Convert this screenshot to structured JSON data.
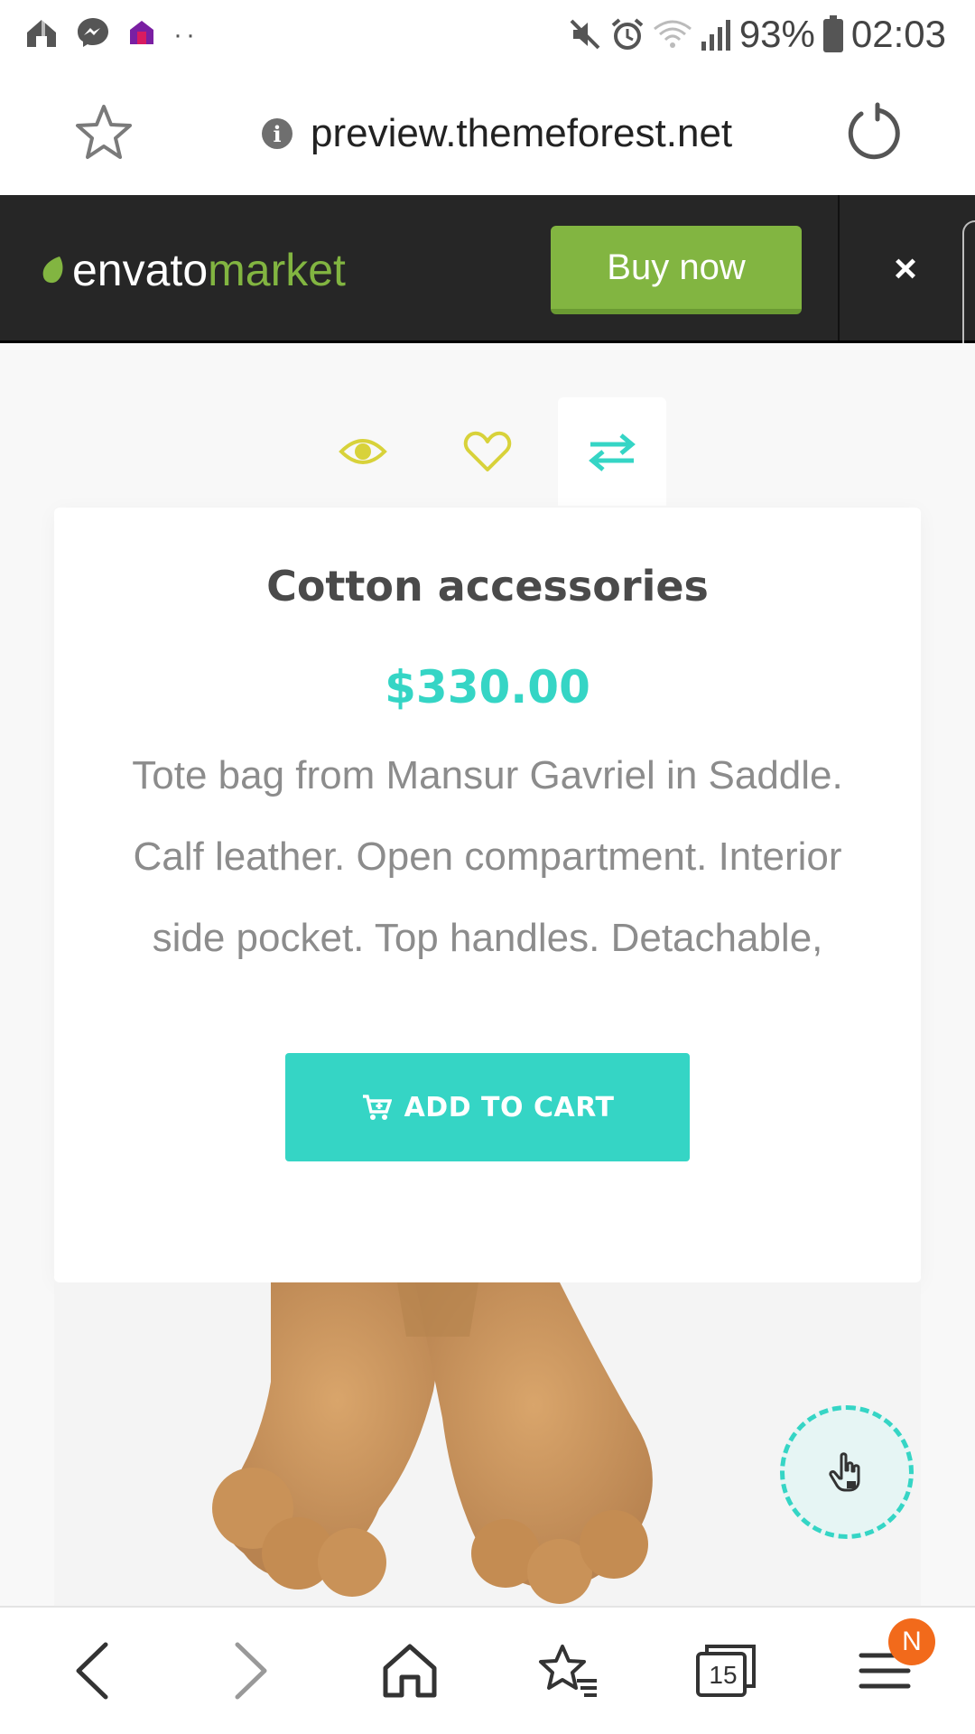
{
  "status_bar": {
    "battery": "93%",
    "time": "02:03"
  },
  "url_bar": {
    "url": "preview.themeforest.net"
  },
  "envato": {
    "logo_part1": "envato",
    "logo_part2": "market",
    "buy_label": "Buy now",
    "close_label": "×"
  },
  "product": {
    "title": "Cotton accessories",
    "price": "$330.00",
    "description": "Tote bag from Mansur Gavriel in Saddle. Calf leather. Open compartment. Interior side pocket. Top handles. Detachable,",
    "add_to_cart": "ADD TO CART"
  },
  "bottom_nav": {
    "tab_count": "15",
    "menu_badge": "N"
  },
  "colors": {
    "accent_teal": "#35d5c5",
    "icon_yellow": "#d8d23a",
    "envato_green": "#82b541",
    "banner_dark": "#262626"
  }
}
